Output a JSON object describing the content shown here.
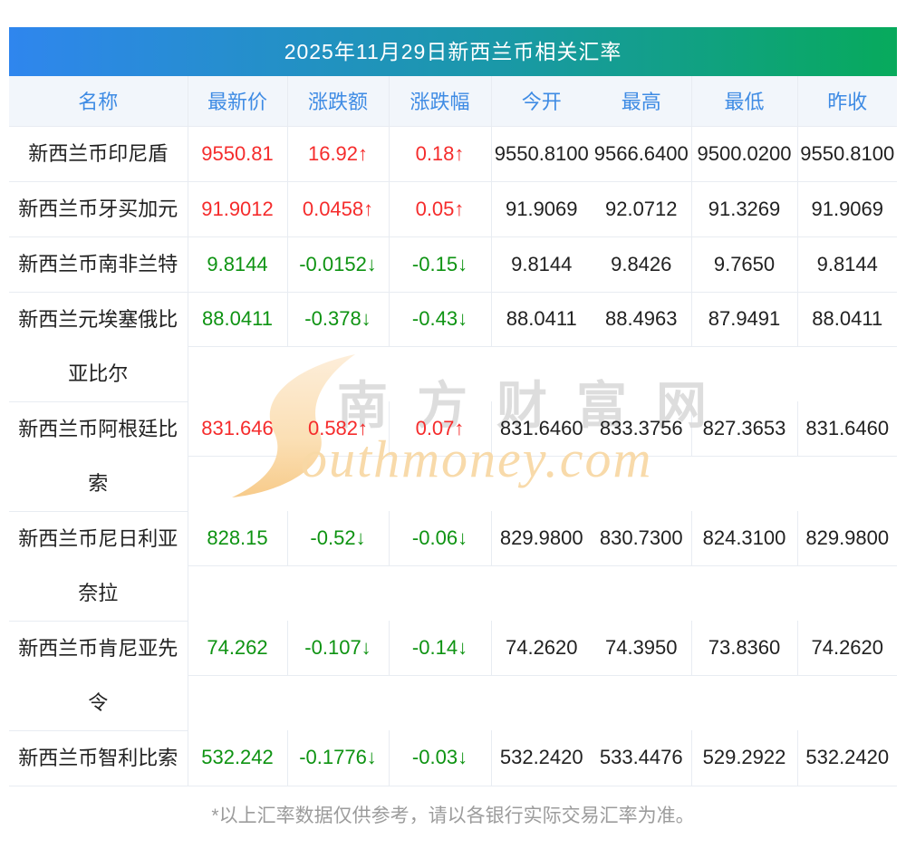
{
  "title": "2025年11月29日新西兰币相关汇率",
  "table": {
    "headers": [
      "名称",
      "最新价",
      "涨跌额",
      "涨跌幅",
      "今开",
      "最高",
      "最低",
      "昨收"
    ],
    "rows": [
      {
        "name": "新西兰币印尼盾",
        "latest": "9550.81",
        "change": "16.92↑",
        "pct": "0.18↑",
        "open": "9550.8100",
        "high": "9566.6400",
        "low": "9500.0200",
        "prev": "9550.8100",
        "trend": "up",
        "tall": false
      },
      {
        "name": "新西兰币牙买加元",
        "latest": "91.9012",
        "change": "0.0458↑",
        "pct": "0.05↑",
        "open": "91.9069",
        "high": "92.0712",
        "low": "91.3269",
        "prev": "91.9069",
        "trend": "up",
        "tall": false
      },
      {
        "name": "新西兰币南非兰特",
        "latest": "9.8144",
        "change": "-0.0152↓",
        "pct": "-0.15↓",
        "open": "9.8144",
        "high": "9.8426",
        "low": "9.7650",
        "prev": "9.8144",
        "trend": "down",
        "tall": false
      },
      {
        "name": "新西兰元埃塞俄比亚比尔",
        "latest": "88.0411",
        "change": "-0.378↓",
        "pct": "-0.43↓",
        "open": "88.0411",
        "high": "88.4963",
        "low": "87.9491",
        "prev": "88.0411",
        "trend": "down",
        "tall": true
      },
      {
        "name": "新西兰币阿根廷比索",
        "latest": "831.646",
        "change": "0.582↑",
        "pct": "0.07↑",
        "open": "831.6460",
        "high": "833.3756",
        "low": "827.3653",
        "prev": "831.6460",
        "trend": "up",
        "tall": true
      },
      {
        "name": "新西兰币尼日利亚奈拉",
        "latest": "828.15",
        "change": "-0.52↓",
        "pct": "-0.06↓",
        "open": "829.9800",
        "high": "830.7300",
        "low": "824.3100",
        "prev": "829.9800",
        "trend": "down",
        "tall": true
      },
      {
        "name": "新西兰币肯尼亚先令",
        "latest": "74.262",
        "change": "-0.107↓",
        "pct": "-0.14↓",
        "open": "74.2620",
        "high": "74.3950",
        "low": "73.8360",
        "prev": "74.2620",
        "trend": "down",
        "tall": true
      },
      {
        "name": "新西兰币智利比索",
        "latest": "532.242",
        "change": "-0.1776↓",
        "pct": "-0.03↓",
        "open": "532.2420",
        "high": "533.4476",
        "low": "529.2922",
        "prev": "532.2420",
        "trend": "down",
        "tall": false
      }
    ]
  },
  "watermark": {
    "cn": "南方财富网",
    "en": "outhmoney.com"
  },
  "footer": "*以上汇率数据仅供参考，请以各银行实际交易汇率为准。",
  "colors": {
    "up": "#f52c2c",
    "down": "#0e9312",
    "header_text": "#3e8be4",
    "gradient_start": "#2f86ee",
    "gradient_end": "#07aa5c"
  }
}
